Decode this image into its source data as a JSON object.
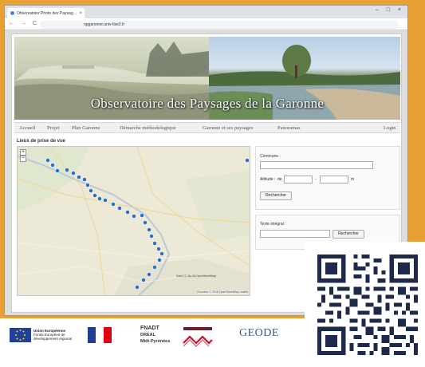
{
  "browser": {
    "tab_title": "Observatoire Photo des Paysag…",
    "tab_close": "×",
    "window_controls": "– □ ×",
    "nav_icons": "← → C",
    "url": "opgaronne.univ-tlse2.fr"
  },
  "site": {
    "banner_title": "Observatoire des Paysages de la Garonne",
    "nav": {
      "accueil": "Accueil",
      "projet": "Projet",
      "plan": "Plan Garonne",
      "demarche": "Démarche méthodologique",
      "paysages": "Garonne et ses paysages",
      "panoramas": "Panoramas",
      "login": "Login"
    },
    "section_title": "Lieux de prise de vue",
    "map": {
      "zoom_in": "+",
      "zoom_out": "−",
      "attribution": "Données © 2018 OpenStreetMap Leaflet",
      "attribution2": "Data CC-By-SA OpenStreetMap"
    },
    "search_panel": {
      "commune_label": "Commune :",
      "altitude_label": "Altitude :",
      "altitude_from_prefix": "de",
      "altitude_dash": "-",
      "altitude_unit": "m",
      "search_button": "Rechercher"
    },
    "text_panel": {
      "label": "Texte intégral :",
      "search_button": "Rechercher"
    }
  },
  "logos": {
    "eu_title": "Union Européenne",
    "eu_sub1": "Fonds Européen de",
    "eu_sub2": "développement régional",
    "fnadt": "FNADT",
    "dreal": "DREAL",
    "region": "Midi-Pyrénées",
    "geode": "GEODE"
  },
  "colors": {
    "background_orange": "#e8a033",
    "marker_blue": "#2b6fc7",
    "qr_navy": "#1e2a4a"
  }
}
